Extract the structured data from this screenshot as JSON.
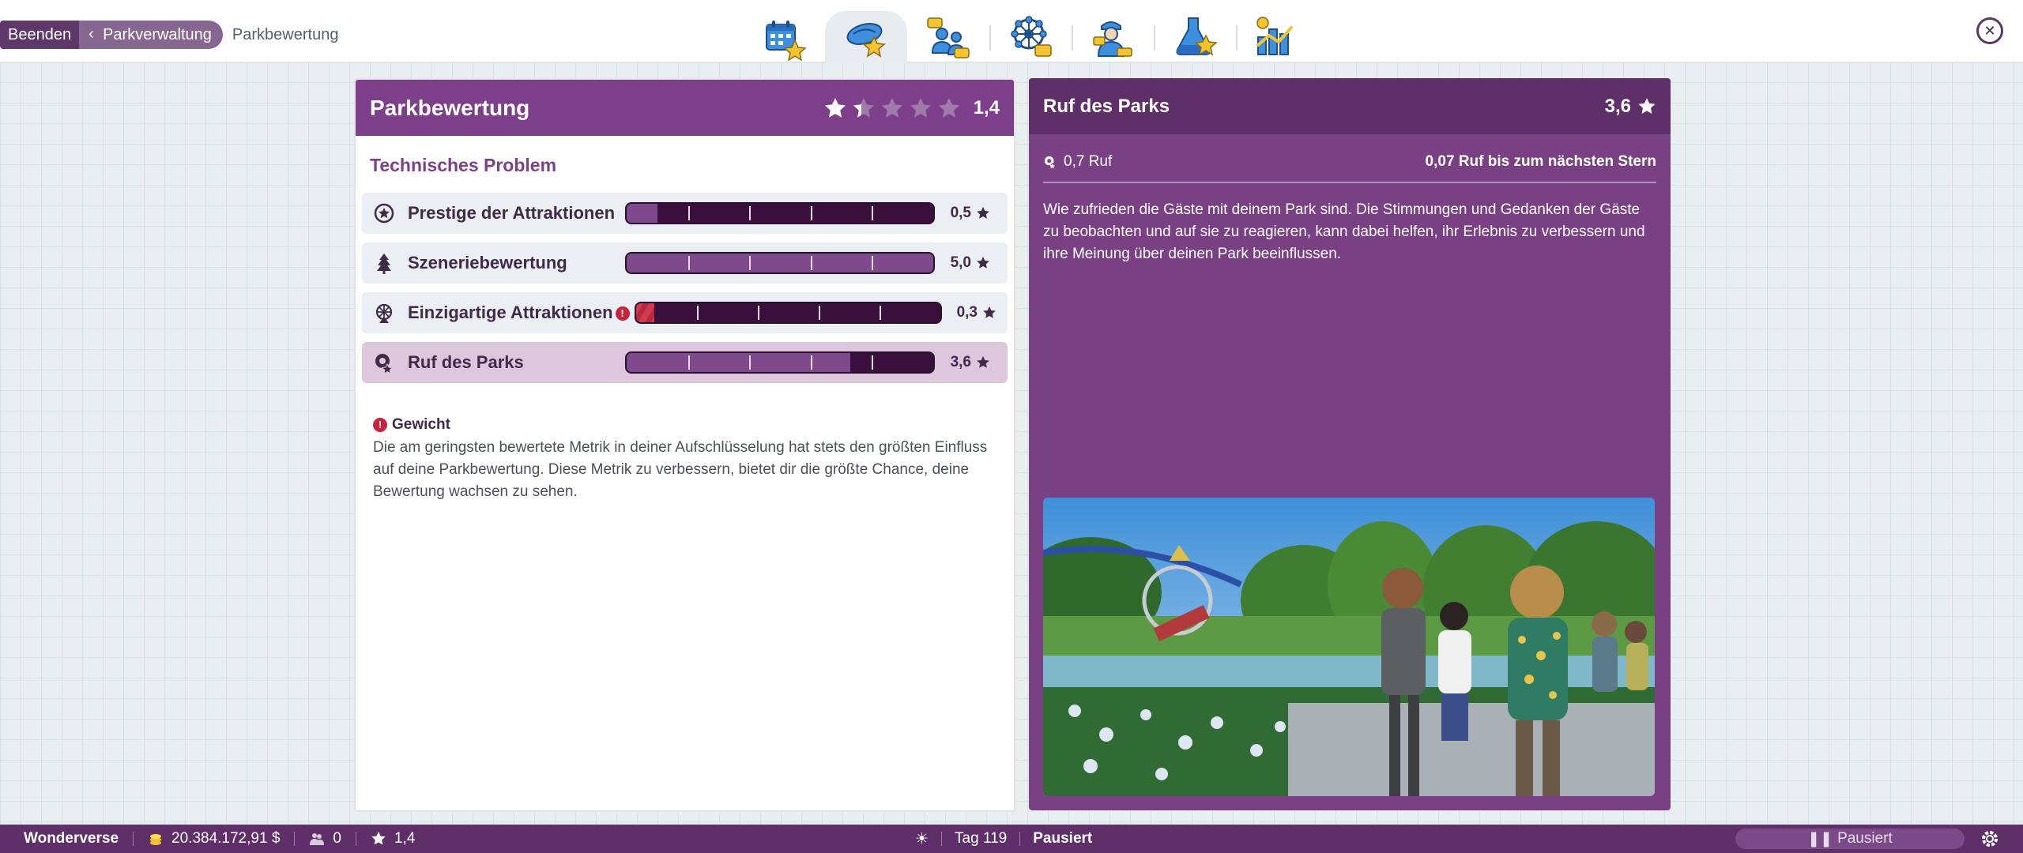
{
  "breadcrumb": {
    "quit": "Beenden",
    "back": "Parkverwaltung",
    "current": "Parkbewertung"
  },
  "tabs": [
    {
      "name": "calendar-icon",
      "active": false
    },
    {
      "name": "park-rating-icon",
      "active": true
    },
    {
      "name": "guests-icon",
      "active": false
    },
    {
      "name": "attractions-icon",
      "active": false
    },
    {
      "name": "staff-icon",
      "active": false
    },
    {
      "name": "research-icon",
      "active": false
    },
    {
      "name": "finances-icon",
      "active": false
    }
  ],
  "left_panel": {
    "title": "Parkbewertung",
    "rating": "1,4",
    "rating_value": 1.4,
    "section_title": "Technisches Problem",
    "metrics": [
      {
        "label": "Prestige der Attraktionen",
        "value": "0,5",
        "level": 0.1,
        "icon": "prestige-icon"
      },
      {
        "label": "Szeneriebewertung",
        "value": "5,0",
        "level": 1.0,
        "icon": "tree-icon"
      },
      {
        "label": "Einzigartige Attraktionen",
        "value": "0,3",
        "level": 0.06,
        "icon": "ferris-wheel-icon",
        "warning": "!"
      },
      {
        "label": "Ruf des Parks",
        "value": "3,6",
        "level": 0.73,
        "icon": "reputation-icon"
      }
    ],
    "note": {
      "icon": "!",
      "title": "Gewicht",
      "body": "Die am geringsten bewertete Metrik in deiner Aufschlüsselung hat stets den größten Einfluss auf deine Parkbewertung. Diese Metrik zu verbessern, bietet dir die größte Chance, deine Bewertung wachsen zu sehen."
    }
  },
  "right_panel": {
    "title": "Ruf des Parks",
    "score": "3,6",
    "reputation": "0,7 Ruf",
    "next_star": "0,07 Ruf bis zum nächsten Stern",
    "description": "Wie zufrieden die Gäste mit deinem Park sind. Die Stimmungen und Gedanken der Gäste zu beobachten und auf sie zu reagieren, kann dabei helfen, ihr Erlebnis zu verbessern und ihre Meinung über deinen Park beeinflussen."
  },
  "bottom_bar": {
    "park_name": "Wonderverse",
    "money": "20.384.172,91 $",
    "guests": "0",
    "rating": "1,4",
    "day": "Tag 119",
    "state": "Pausiert",
    "speed_label": "Pausiert"
  },
  "colors": {
    "header_purple": "#7d3f8a",
    "dark_purple": "#5e2f69",
    "bar_dark": "#3a0f3c",
    "bar_fill": "#7e4a8c",
    "warning_red": "#c8233a"
  }
}
